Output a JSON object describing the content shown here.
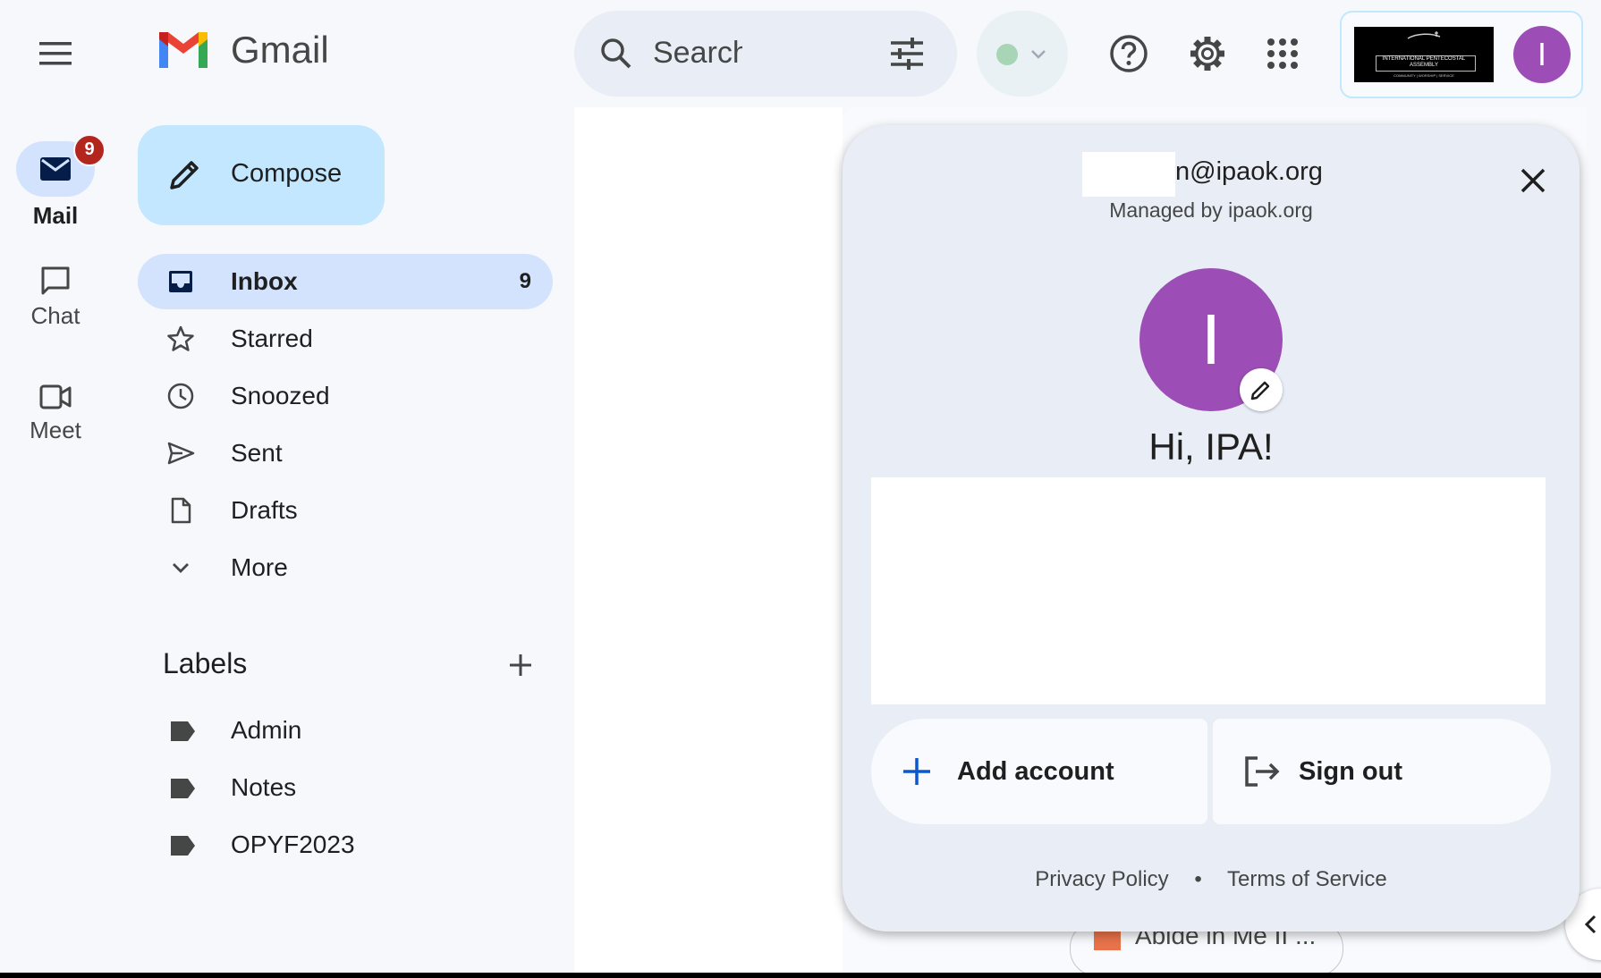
{
  "app": {
    "name": "Gmail"
  },
  "rail": {
    "mail": {
      "label": "Mail",
      "badge": "9"
    },
    "chat": {
      "label": "Chat"
    },
    "meet": {
      "label": "Meet"
    }
  },
  "compose": {
    "label": "Compose"
  },
  "nav": [
    {
      "label": "Inbox",
      "count": "9",
      "icon": "inbox-icon",
      "selected": true
    },
    {
      "label": "Starred",
      "icon": "star-icon"
    },
    {
      "label": "Snoozed",
      "icon": "clock-icon"
    },
    {
      "label": "Sent",
      "icon": "send-icon"
    },
    {
      "label": "Drafts",
      "icon": "draft-icon"
    },
    {
      "label": "More",
      "icon": "chevron-down-icon"
    }
  ],
  "labels": {
    "heading": "Labels",
    "items": [
      "Admin",
      "Notes",
      "OPYF2023"
    ]
  },
  "search": {
    "placeholder": "Search in m"
  },
  "header": {
    "org_logo_text": "INTERNATIONAL PENTECOSTAL ASSEMBLY",
    "org_logo_subtext": "COMMUNITY | WORSHIP | SERVICE",
    "avatar_letter": "I"
  },
  "account_popup": {
    "email_visible": "n@ipaok.org",
    "managed_by": "Managed by ipaok.org",
    "avatar_letter": "I",
    "greeting": "Hi, IPA!",
    "add_account": "Add account",
    "sign_out": "Sign out",
    "privacy": "Privacy Policy",
    "separator": "•",
    "terms": "Terms of Service"
  },
  "background_partial": {
    "chip_text": "Abide in Me II ..."
  },
  "colors": {
    "background": "#f6f8fc",
    "compose": "#c2e7ff",
    "selected": "#d3e3fd",
    "avatar": "#9c4db6",
    "badge": "#b3261e",
    "popup": "#e9eef6",
    "accent_blue": "#0b57d0"
  }
}
